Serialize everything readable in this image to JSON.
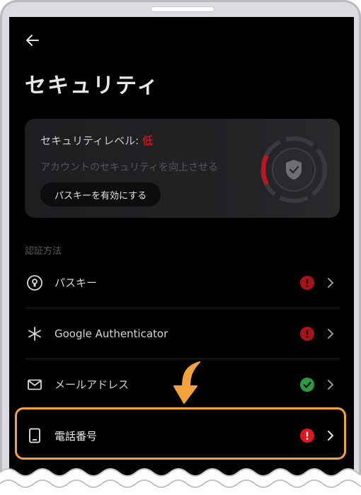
{
  "header": {
    "title": "セキュリティ"
  },
  "security_card": {
    "level_label": "セキュリティレベル: ",
    "level_value": "低",
    "description": "アカウントのセキュリティを向上させる",
    "passkey_button": "パスキーを有効にする"
  },
  "auth": {
    "section_label": "認証方法",
    "methods": [
      {
        "label": "パスキー",
        "status": "warning"
      },
      {
        "label": "Google Authenticator",
        "status": "warning"
      },
      {
        "label": "メールアドレス",
        "status": "verified"
      },
      {
        "label": "電話番号",
        "status": "warning"
      }
    ]
  },
  "colors": {
    "warning": "#e0151f",
    "verified": "#2fb34a",
    "highlight": "#f5a23c",
    "background": "#000000"
  }
}
